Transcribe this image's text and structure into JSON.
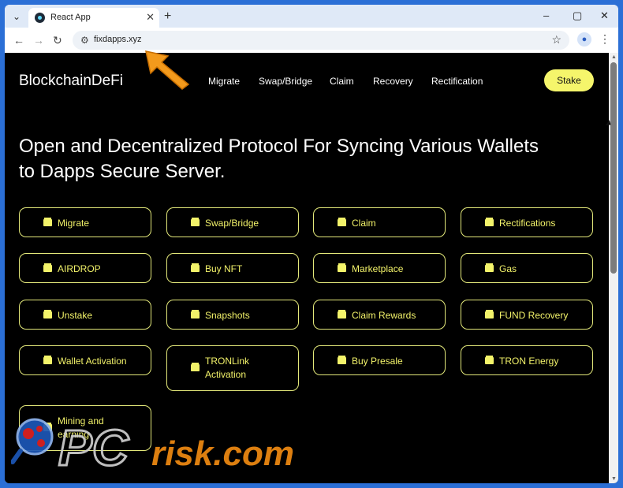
{
  "browser": {
    "tab_menu_icon": "chevron-down-icon",
    "tab_title": "React App",
    "tab_close_icon": "close-icon",
    "new_tab_icon": "plus-icon",
    "url": "fixdapps.xyz",
    "back_icon": "←",
    "forward_icon": "→",
    "reload_icon": "↻",
    "minimize_icon": "–",
    "maximize_icon": "▢",
    "close_icon": "✕"
  },
  "site": {
    "brand": "BlockchainDeFi",
    "nav": [
      "Migrate",
      "Swap/Bridge",
      "Claim",
      "Recovery",
      "Rectification"
    ],
    "stake_button": "Stake",
    "headline": "Open and Decentralized Protocol For Syncing Various Wallets to Dapps Secure Server.",
    "cards": [
      [
        "Migrate",
        "Swap/Bridge",
        "Claim",
        "Rectifications"
      ],
      [
        "AIRDROP",
        "Buy NFT",
        "Marketplace",
        "Gas"
      ],
      [
        "Unstake",
        "Snapshots",
        "Claim Rewards",
        "FUND Recovery"
      ],
      [
        "Wallet Activation",
        "TRONLink Activation",
        "Buy Presale",
        "TRON Energy"
      ],
      [
        "Mining and earning"
      ]
    ]
  },
  "colors": {
    "accent": "#f3f36a",
    "stake_bg": "#f5f56b",
    "page_bg": "#000000",
    "browser_bg": "#dfe9f7"
  },
  "watermark": {
    "text_pc": "PC",
    "text_risk": "risk.com"
  }
}
